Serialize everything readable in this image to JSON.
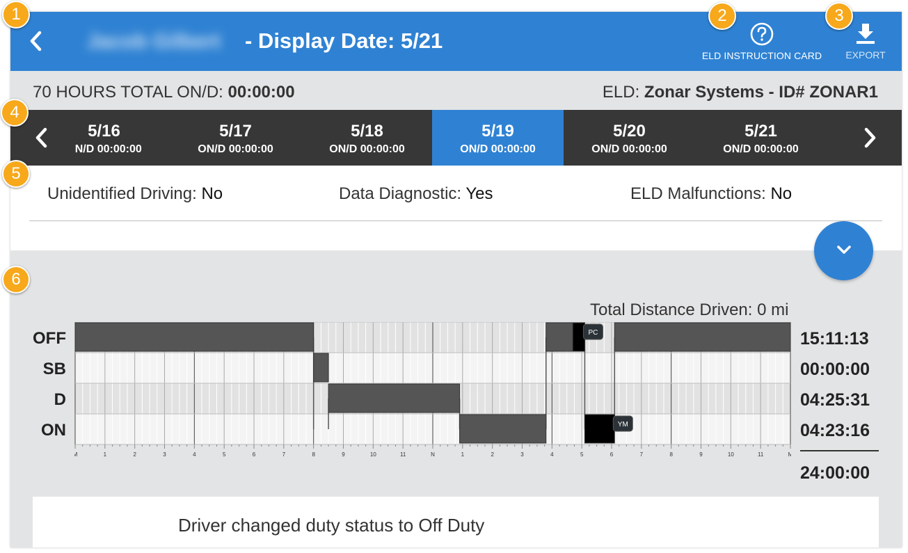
{
  "header": {
    "driver_name": "Jacob Gilbert",
    "title": "- Display Date: 5/21",
    "eld_card_label": "ELD INSTRUCTION CARD",
    "export_label": "EXPORT",
    "icons": {
      "back": "chevron-left-icon",
      "help": "question-circle-icon",
      "export": "download-icon"
    }
  },
  "summary": {
    "hours_label": "70 HOURS TOTAL ON/D:",
    "hours_value": "00:00:00",
    "eld_label": "ELD:",
    "eld_value": "Zonar Systems - ID# ZONAR1"
  },
  "date_strip": {
    "days": [
      {
        "date": "5/16",
        "hours": "ON/D 00:00:00"
      },
      {
        "date": "5/17",
        "hours": "ON/D 00:00:00"
      },
      {
        "date": "5/18",
        "hours": "ON/D 00:00:00"
      },
      {
        "date": "5/19",
        "hours": "ON/D 00:00:00"
      },
      {
        "date": "5/20",
        "hours": "ON/D 00:00:00"
      },
      {
        "date": "5/21",
        "hours": "ON/D 00:00:00"
      }
    ],
    "selected_index": 3
  },
  "status": {
    "unidentified_label": "Unidentified Driving:",
    "unidentified_value": "No",
    "diagnostic_label": "Data Diagnostic:",
    "diagnostic_value": "Yes",
    "malfunction_label": "ELD Malfunctions:",
    "malfunction_value": "No"
  },
  "log": {
    "distance_label": "Total Distance Driven:",
    "distance_value": "0 mi",
    "rows": [
      {
        "label": "OFF",
        "total": "15:11:13"
      },
      {
        "label": "SB",
        "total": "00:00:00"
      },
      {
        "label": "D",
        "total": "04:25:31"
      },
      {
        "label": "ON",
        "total": "04:23:16"
      }
    ],
    "grand_total": "24:00:00",
    "hour_labels": [
      "M",
      "1",
      "2",
      "3",
      "4",
      "5",
      "6",
      "7",
      "8",
      "9",
      "10",
      "11",
      "N",
      "1",
      "2",
      "3",
      "4",
      "5",
      "6",
      "7",
      "8",
      "9",
      "10",
      "11",
      "M"
    ],
    "segments": [
      {
        "row": 0,
        "start": 0,
        "end": 8.0
      },
      {
        "row": 1,
        "start": 8.0,
        "end": 8.5
      },
      {
        "row": 2,
        "start": 8.5,
        "end": 12.9
      },
      {
        "row": 3,
        "start": 12.9,
        "end": 15.8
      },
      {
        "row": 0,
        "start": 15.8,
        "end": 16.7
      },
      {
        "row": 0,
        "start": 16.7,
        "end": 17.1,
        "highlight": true
      },
      {
        "row": 3,
        "start": 17.1,
        "end": 18.1,
        "highlight": true
      },
      {
        "row": 0,
        "start": 18.1,
        "end": 24.0
      }
    ],
    "transitions": [
      {
        "at": 8.0,
        "from": 0,
        "to": 3
      },
      {
        "at": 8.5,
        "from": 3,
        "to": 2
      },
      {
        "at": 12.9,
        "from": 2,
        "to": 3
      },
      {
        "at": 15.8,
        "from": 3,
        "to": 0
      },
      {
        "at": 17.1,
        "from": 0,
        "to": 3
      },
      {
        "at": 18.1,
        "from": 3,
        "to": 0
      }
    ],
    "tags": [
      {
        "text": "PC",
        "row": 0,
        "at": 17.1
      },
      {
        "text": "YM",
        "row": 3,
        "at": 18.1
      }
    ]
  },
  "event": {
    "text": "Driver changed duty status to Off Duty"
  },
  "callouts": [
    "1",
    "2",
    "3",
    "4",
    "5",
    "6"
  ],
  "colors": {
    "accent": "#2f82d3",
    "strip": "#373737",
    "bar": "#555555",
    "highlight": "#000000",
    "callout": "#f7a81b"
  }
}
